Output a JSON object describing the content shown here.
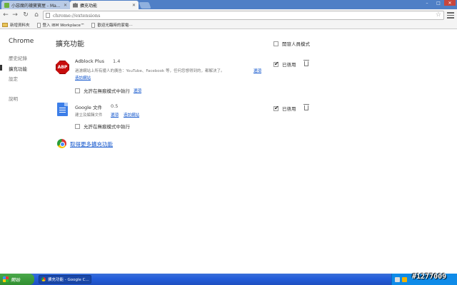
{
  "tabs": [
    {
      "label": "小惡魔的襪寶寶屋 - Ma...",
      "active": false
    },
    {
      "label": "擴充功能",
      "active": true
    }
  ],
  "address_bar": {
    "url": "chrome://extensions"
  },
  "bookmarks": [
    {
      "label": "新增資料夾",
      "type": "folder"
    },
    {
      "label": "登入 IBM Workplace™",
      "type": "page"
    },
    {
      "label": "歡迎光臨時的家電⋯",
      "type": "page"
    }
  ],
  "sidebar": {
    "brand": "Chrome",
    "items": [
      {
        "label": "歷史紀錄",
        "selected": false
      },
      {
        "label": "擴充功能",
        "selected": true
      },
      {
        "label": "設定",
        "selected": false
      },
      {
        "label": "說明",
        "selected": false
      }
    ]
  },
  "main": {
    "title": "擴充功能",
    "developer_mode_label": "開發人員模式",
    "extensions": [
      {
        "name": "Adblock Plus",
        "version": "1.4",
        "description": "過濾網站上所有擾人的廣告：YouTube、Facebook 等，任何您想得到的，都解決了。",
        "links": [
          "選項",
          "造訪網站"
        ],
        "incognito_label": "允許在無痕模式中執行",
        "incognito_link": "選項",
        "enabled_label": "已啓用",
        "enabled": true
      },
      {
        "name": "Google 文件",
        "version": "0.5",
        "description": "建立及編輯文件",
        "links": [
          "選項",
          "造訪網站"
        ],
        "incognito_label": "允許在無痕模式中執行",
        "enabled_label": "已啓用",
        "enabled": true
      }
    ],
    "get_more_label": "取得更多擴充功能"
  },
  "taskbar": {
    "start_label": "開始",
    "task_label": "擴充功能 - Google C..."
  },
  "watermark": "#1277009",
  "colors": {
    "link": "#1155cc",
    "abp_red": "#c70d0d",
    "gdocs_blue": "#3c7ee8",
    "taskbar_blue": "#245edb",
    "start_green": "#2f8f2f"
  }
}
